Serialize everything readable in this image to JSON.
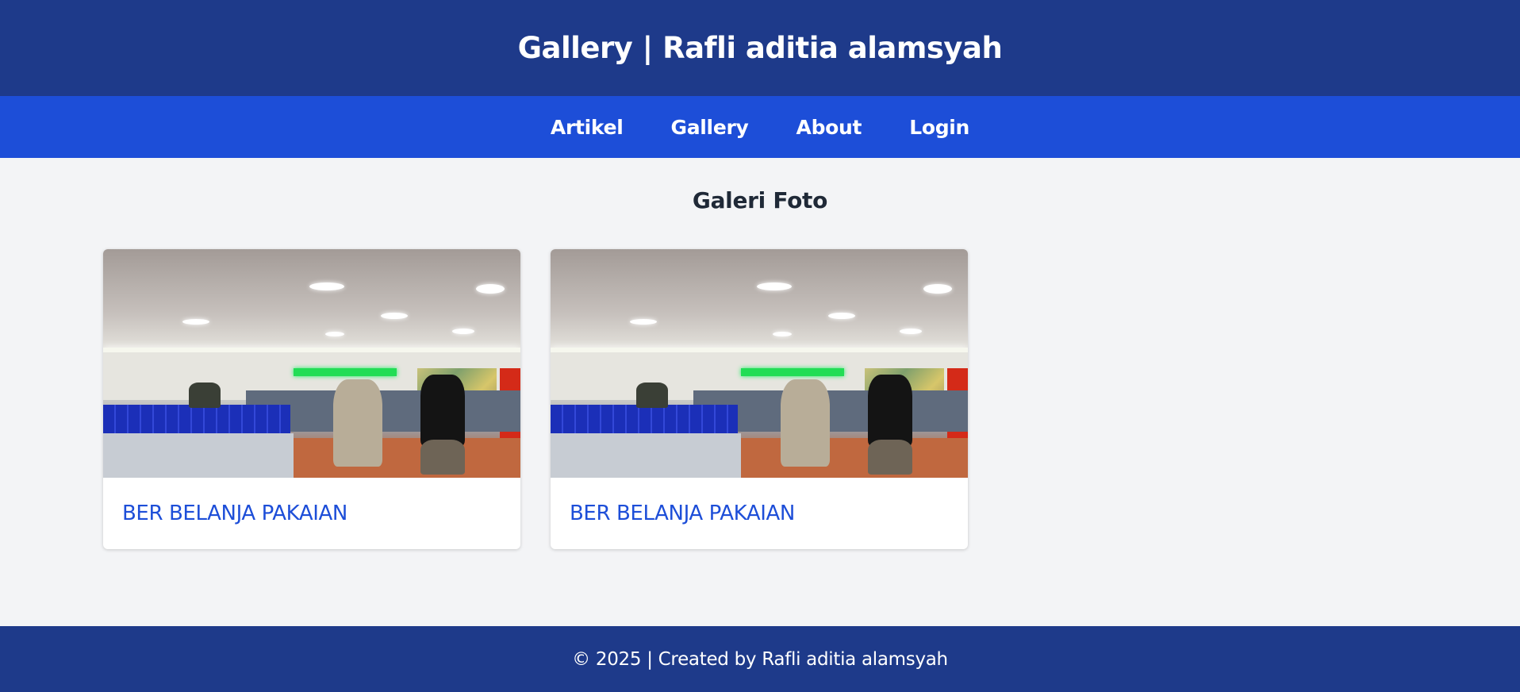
{
  "header": {
    "title": "Gallery | Rafli aditia alamsyah"
  },
  "nav": {
    "items": [
      "Artikel",
      "Gallery",
      "About",
      "Login"
    ]
  },
  "main": {
    "section_title": "Galeri Foto",
    "cards": [
      {
        "caption": "BER BELANJA PAKAIAN",
        "image": "store-checkout-photo"
      },
      {
        "caption": "BER BELANJA PAKAIAN",
        "image": "store-checkout-photo"
      }
    ]
  },
  "footer": {
    "text": "© 2025 | Created by Rafli aditia alamsyah"
  },
  "colors": {
    "header_bg": "#1e3a8a",
    "nav_bg": "#1d4ed8",
    "page_bg": "#f3f4f6",
    "link": "#1d4ed8",
    "heading": "#1f2937"
  }
}
